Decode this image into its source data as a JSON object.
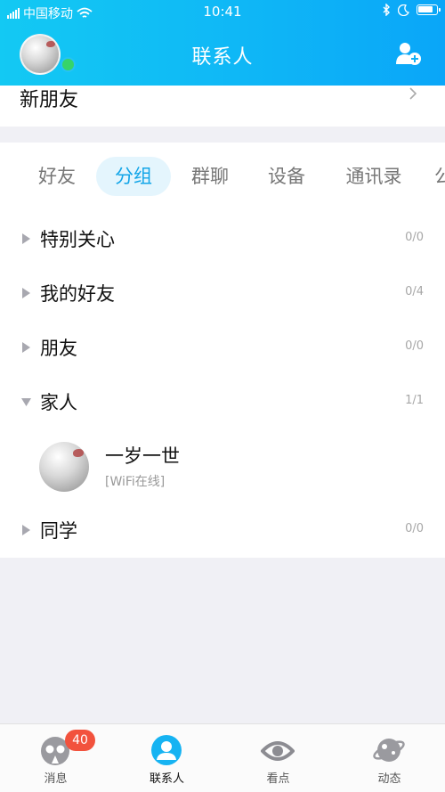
{
  "status_bar": {
    "carrier": "中国移动",
    "time": "10:41"
  },
  "header": {
    "title": "联系人"
  },
  "new_friends": {
    "label": "新朋友"
  },
  "tabs": [
    {
      "label": "好友"
    },
    {
      "label": "分组",
      "active": true
    },
    {
      "label": "群聊"
    },
    {
      "label": "设备"
    },
    {
      "label": "通讯录"
    },
    {
      "label": "公"
    }
  ],
  "groups": [
    {
      "name": "特别关心",
      "count": "0/0",
      "expanded": false
    },
    {
      "name": "我的好友",
      "count": "0/4",
      "expanded": false
    },
    {
      "name": "朋友",
      "count": "0/0",
      "expanded": false
    },
    {
      "name": "家人",
      "count": "1/1",
      "expanded": true
    },
    {
      "name": "同学",
      "count": "0/0",
      "expanded": false
    }
  ],
  "friend": {
    "name": "一岁一世",
    "status": "[WiFi在线]"
  },
  "bottom_nav": {
    "items": [
      {
        "label": "消息",
        "icon": "messages-icon",
        "badge": "40"
      },
      {
        "label": "联系人",
        "icon": "contacts-icon",
        "active": true
      },
      {
        "label": "看点",
        "icon": "eye-icon"
      },
      {
        "label": "动态",
        "icon": "planet-icon"
      }
    ]
  },
  "colors": {
    "header_start": "#13c9f3",
    "header_end": "#0aa6f8",
    "accent": "#12a5e8",
    "badge": "#f2523d",
    "online": "#36d46a"
  }
}
